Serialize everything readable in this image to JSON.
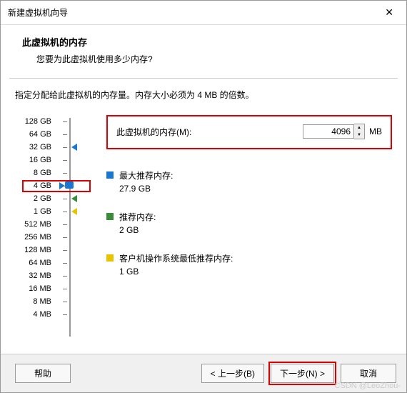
{
  "window": {
    "title": "新建虚拟机向导",
    "close": "✕"
  },
  "header": {
    "title": "此虚拟机的内存",
    "subtitle": "您要为此虚拟机使用多少内存?"
  },
  "instruction": "指定分配给此虚拟机的内存量。内存大小必须为 4 MB 的倍数。",
  "input": {
    "label": "此虚拟机的内存(M):",
    "value": "4096",
    "unit": "MB"
  },
  "scale": [
    "128 GB",
    "64 GB",
    "32 GB",
    "16 GB",
    "8 GB",
    "4 GB",
    "2 GB",
    "1 GB",
    "512 MB",
    "256 MB",
    "128 MB",
    "64 MB",
    "32 MB",
    "16 MB",
    "8 MB",
    "4 MB"
  ],
  "info": {
    "max": {
      "label": "最大推荐内存:",
      "value": "27.9 GB"
    },
    "rec": {
      "label": "推荐内存:",
      "value": "2 GB"
    },
    "min": {
      "label": "客户机操作系统最低推荐内存:",
      "value": "1 GB"
    }
  },
  "footer": {
    "help": "帮助",
    "back": "< 上一步(B)",
    "next": "下一步(N) >",
    "cancel": "取消"
  },
  "watermark": "CSDN @LeoZhou-"
}
